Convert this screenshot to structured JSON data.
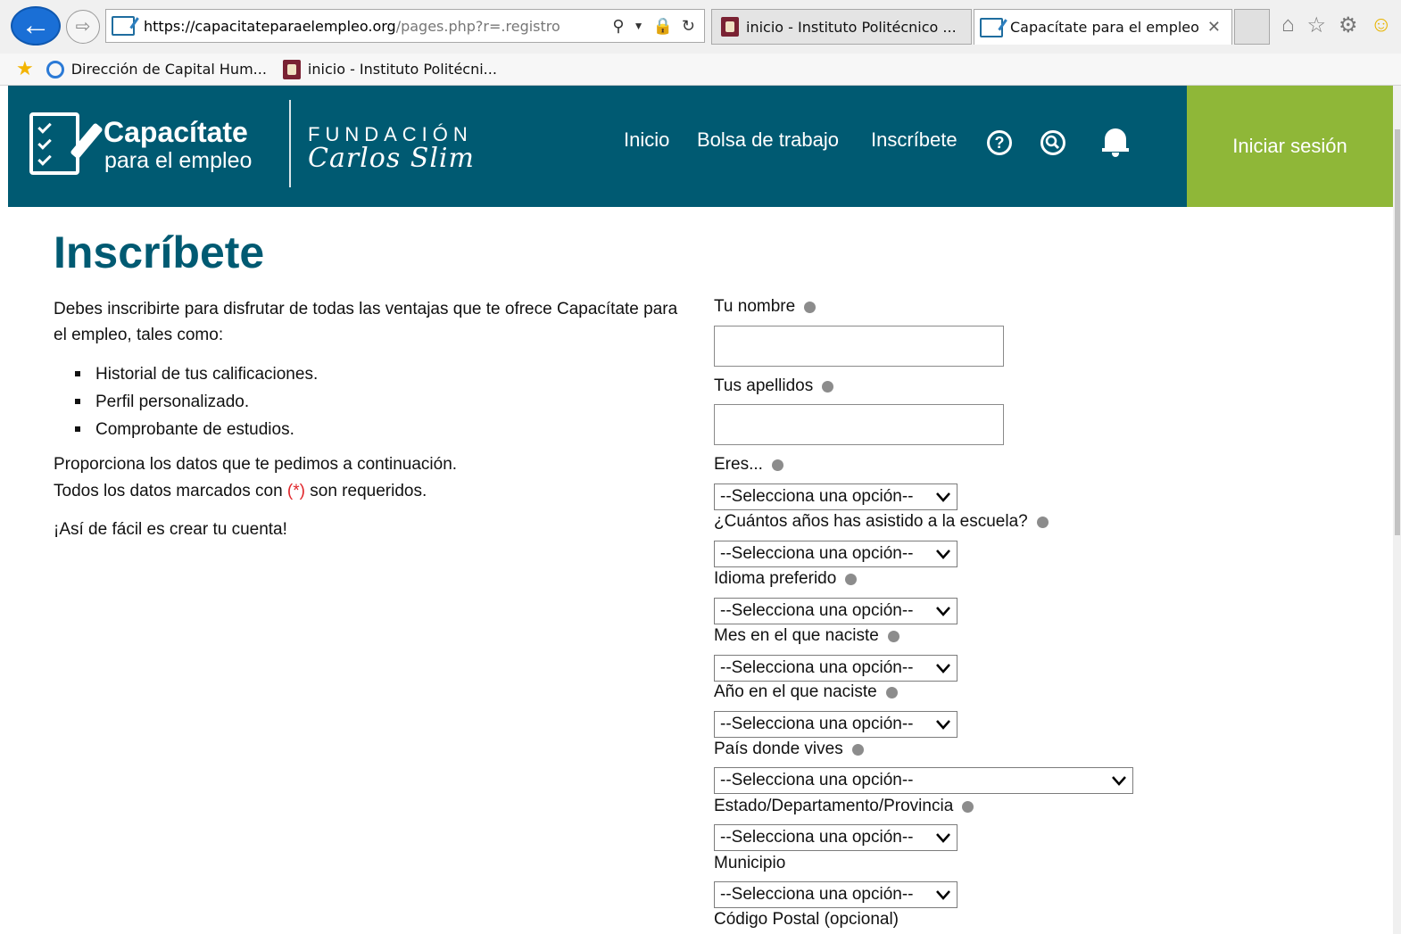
{
  "browser": {
    "url_main": "https://capacitateparaelempleo.org",
    "url_rest": "/pages.php?r=.registro",
    "tabs": [
      {
        "label": "inicio - Instituto Politécnico ..."
      },
      {
        "label": "Capacítate para el empleo"
      }
    ],
    "favorites": [
      {
        "label": "Dirección de Capital Hum..."
      },
      {
        "label": "inicio - Instituto Politécni..."
      }
    ]
  },
  "header": {
    "brand_title": "Capacítate",
    "brand_subtitle": "para el empleo",
    "fundacion": "FUNDACIÓN",
    "carlos": "Carlos Slim",
    "nav": [
      {
        "label": "Inicio"
      },
      {
        "label": "Bolsa de trabajo"
      },
      {
        "label": "Inscríbete"
      }
    ],
    "help_glyph": "?",
    "login": "Iniciar sesión"
  },
  "page": {
    "title": "Inscríbete",
    "intro": "Debes inscribirte para disfrutar de todas las ventajas que te ofrece Capacítate para el empleo, tales como:",
    "benefits": [
      "Historial de tus calificaciones.",
      "Perfil personalizado.",
      "Comprobante de estudios."
    ],
    "line1": "Proporciona los datos que te pedimos a continuación.",
    "line2_before": "Todos los datos marcados con ",
    "line2_mark": "(*)",
    "line2_after": " son requeridos.",
    "line3": "¡Así de fácil es crear tu cuenta!"
  },
  "form": {
    "nombre_label": "Tu nombre",
    "nombre_value": "",
    "apellidos_label": "Tus apellidos",
    "apellidos_value": "",
    "selects": [
      {
        "label": "Eres...",
        "value": "--Selecciona una opción--"
      },
      {
        "label": "¿Cuántos años has asistido a la escuela?",
        "value": "--Selecciona una opción--"
      },
      {
        "label": "Idioma preferido",
        "value": "--Selecciona una opción--"
      },
      {
        "label": "Mes en el que naciste",
        "value": "--Selecciona una opción--"
      },
      {
        "label": "Año en el que naciste",
        "value": "--Selecciona una opción--"
      },
      {
        "label": "País donde vives",
        "value": "--Selecciona una opción--"
      },
      {
        "label": "Estado/Departamento/Provincia",
        "value": "--Selecciona una opción--"
      },
      {
        "label": "Municipio",
        "value": "--Selecciona una opción--"
      }
    ],
    "postal_label": "Código Postal (opcional)"
  },
  "colors": {
    "header_bg": "#005a72",
    "login_bg": "#8fb738",
    "title": "#005a72",
    "required_mark": "#e0262b"
  }
}
